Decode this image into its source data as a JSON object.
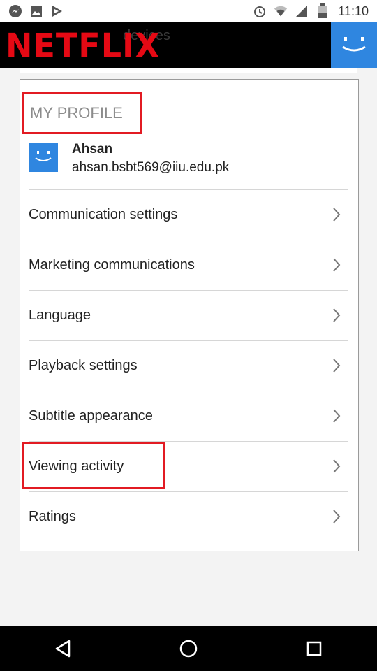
{
  "status_bar": {
    "icons_left": [
      "messenger-icon",
      "image-icon",
      "play-store-icon"
    ],
    "icons_right": [
      "alarm-icon",
      "wifi-icon",
      "signal-icon",
      "battery-icon"
    ],
    "time": "11:10"
  },
  "header": {
    "logo_text": "NETFLIX",
    "underlying_title": "devices",
    "brand_color": "#e50914",
    "avatar_color": "#2f86e0"
  },
  "profile": {
    "section_title": "MY PROFILE",
    "user_name": "Ahsan",
    "user_email": "ahsan.bsbt569@iiu.edu.pk",
    "menu_items": [
      {
        "label": "Communication settings"
      },
      {
        "label": "Marketing communications"
      },
      {
        "label": "Language"
      },
      {
        "label": "Playback settings"
      },
      {
        "label": "Subtitle appearance"
      },
      {
        "label": "Viewing activity"
      },
      {
        "label": "Ratings"
      }
    ],
    "highlight_color": "#e21b23"
  },
  "nav_bar": {
    "buttons": [
      "back-icon",
      "home-icon",
      "recents-icon"
    ]
  }
}
